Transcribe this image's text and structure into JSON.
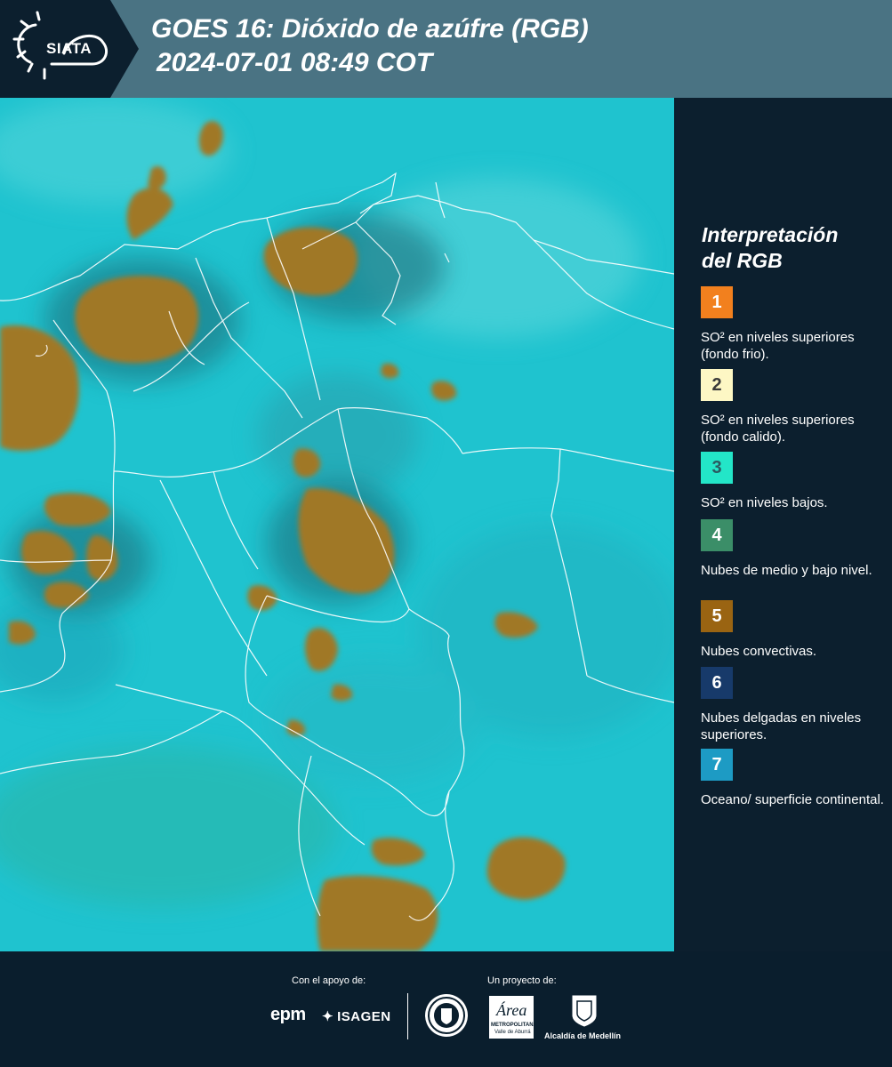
{
  "header": {
    "brand": "SIATA",
    "title_line1": "GOES 16: Dióxido de azúfre (RGB)",
    "title_line2": "2024-07-01 08:49 COT"
  },
  "legend": {
    "title_line1": "Interpretación",
    "title_line2": "del RGB",
    "items": [
      {
        "number": "1",
        "label": "SO² en niveles superiores (fondo frio).",
        "color": "#f2801e",
        "text_color": "#ffffff"
      },
      {
        "number": "2",
        "label": "SO² en niveles superiores (fondo calido).",
        "color": "#fdf7c4",
        "text_color": "#3a3a3a"
      },
      {
        "number": "3",
        "label": "SO² en niveles bajos.",
        "color": "#23e6c8",
        "text_color": "#2a5a60"
      },
      {
        "number": "4",
        "label": "Nubes de medio y bajo nivel.",
        "color": "#3b8e68",
        "text_color": "#ffffff"
      },
      {
        "number": "5",
        "label": "Nubes convectivas.",
        "color": "#9a6412",
        "text_color": "#ffffff"
      },
      {
        "number": "6",
        "label": "Nubes delgadas en niveles superiores.",
        "color": "#173a6a",
        "text_color": "#ffffff"
      },
      {
        "number": "7",
        "label": "Oceano/ superficie continental.",
        "color": "#1d9bc4",
        "text_color": "#ffffff"
      }
    ]
  },
  "footer": {
    "support_label": "Con el apoyo de:",
    "project_label": "Un proyecto de:",
    "sponsor1": "epm",
    "sponsor2": "ISAGEN",
    "partner2_name": "Área",
    "partner2_sub": "METROPOLITANA",
    "partner2_sub2": "Valle de Aburrá",
    "partner3": "Alcaldía de Medellín"
  },
  "map": {
    "background_color": "#1fc3cf",
    "cloud_color": "#a07828",
    "border_color": "#ffffff"
  }
}
